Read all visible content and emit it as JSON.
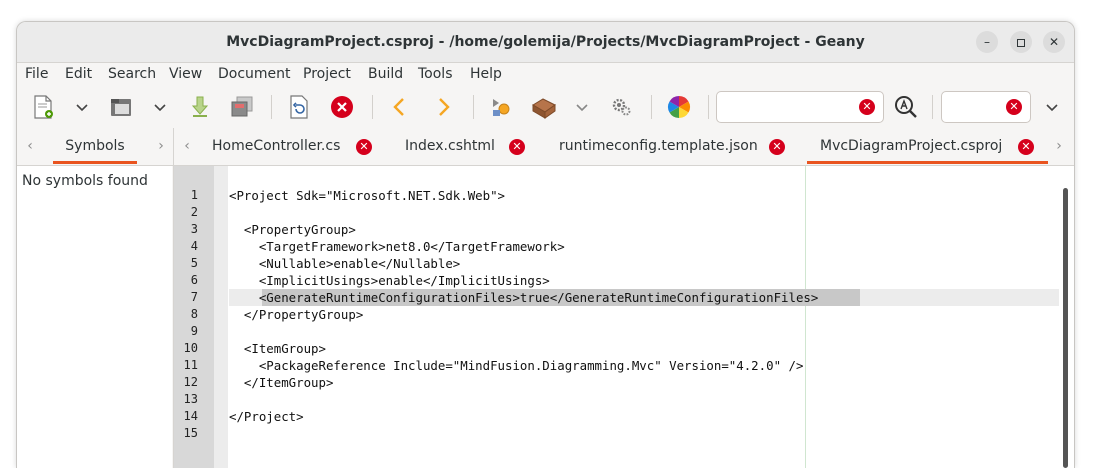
{
  "window": {
    "title": "MvcDiagramProject.csproj - /home/golemija/Projects/MvcDiagramProject - Geany"
  },
  "menu": [
    "File",
    "Edit",
    "Search",
    "View",
    "Document",
    "Project",
    "Build",
    "Tools",
    "Help"
  ],
  "toolbar": {
    "search_value": "",
    "goto_value": ""
  },
  "sidebar": {
    "tab_label": "Symbols",
    "empty_text": "No symbols found"
  },
  "tabs": [
    {
      "label": "HomeController.cs",
      "active": false
    },
    {
      "label": "Index.cshtml",
      "active": false
    },
    {
      "label": "runtimeconfig.template.json",
      "active": false
    },
    {
      "label": "MvcDiagramProject.csproj",
      "active": true
    }
  ],
  "editor": {
    "current_line": 7,
    "lines": [
      "<Project Sdk=\"Microsoft.NET.Sdk.Web\">",
      "",
      "  <PropertyGroup>",
      "    <TargetFramework>net8.0</TargetFramework>",
      "    <Nullable>enable</Nullable>",
      "    <ImplicitUsings>enable</ImplicitUsings>",
      "    <GenerateRuntimeConfigurationFiles>true</GenerateRuntimeConfigurationFiles>",
      "  </PropertyGroup>",
      "",
      "  <ItemGroup>",
      "    <PackageReference Include=\"MindFusion.Diagramming.Mvc\" Version=\"4.2.0\" />",
      "  </ItemGroup>",
      "",
      "</Project>",
      ""
    ],
    "line_numbers": [
      "1",
      "2",
      "3",
      "4",
      "5",
      "6",
      "7",
      "8",
      "9",
      "10",
      "11",
      "12",
      "13",
      "14",
      "15"
    ]
  },
  "colors": {
    "accent": "#e95420",
    "close_red": "#d5001c"
  }
}
